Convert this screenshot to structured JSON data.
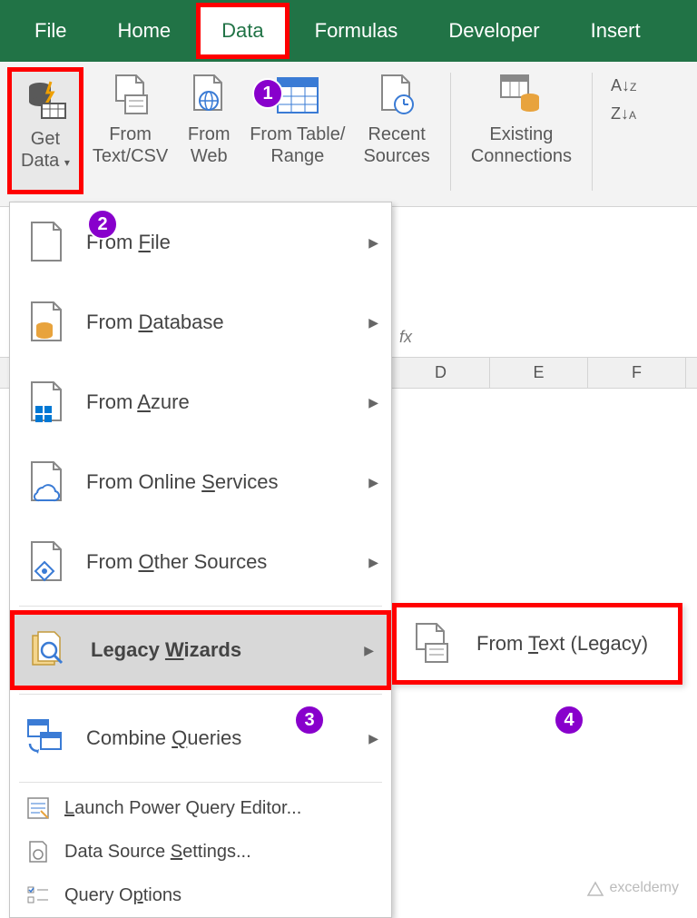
{
  "tabs": {
    "file": "File",
    "home": "Home",
    "data": "Data",
    "formulas": "Formulas",
    "developer": "Developer",
    "insert": "Insert"
  },
  "ribbon": {
    "getdata": "Get\nData",
    "textcsv": "From\nText/CSV",
    "web": "From\nWeb",
    "table": "From Table/\nRange",
    "recent": "Recent\nSources",
    "existing": "Existing\nConnections",
    "sort_az": "A→Z",
    "sort_za": "Z→A"
  },
  "menu": {
    "file_pre": "From ",
    "file_u": "F",
    "file_post": "ile",
    "db_pre": "From ",
    "db_u": "D",
    "db_post": "atabase",
    "az_pre": "From ",
    "az_u": "A",
    "az_post": "zure",
    "os_pre": "From Online ",
    "os_u": "S",
    "os_post": "ervices",
    "other_pre": "From ",
    "other_u": "O",
    "other_post": "ther Sources",
    "lw_pre": "Legacy ",
    "lw_u": "W",
    "lw_post": "izards",
    "cq_pre": "Combine ",
    "cq_u": "Q",
    "cq_post": "ueries",
    "launch_u": "L",
    "launch_post": "aunch Power Query Editor...",
    "dss_pre": "Data Source ",
    "dss_u": "S",
    "dss_post": "ettings...",
    "qo_pre": "Query O",
    "qo_u": "p",
    "qo_post": "tions"
  },
  "submenu": {
    "ft_pre": "From ",
    "ft_u": "T",
    "ft_post": "ext (Legacy)"
  },
  "callouts": {
    "c1": "1",
    "c2": "2",
    "c3": "3",
    "c4": "4"
  },
  "cols": {
    "d": "D",
    "e": "E",
    "f": "F"
  },
  "fx": "fx",
  "watermark": "exceldemy"
}
